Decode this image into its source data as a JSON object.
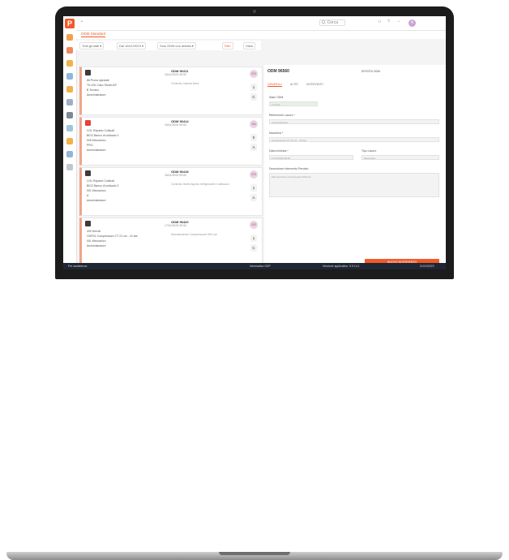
{
  "app": {
    "logo_letter": "P",
    "tab_label": "ODM Standard",
    "search_placeholder": "Q. Cerca",
    "avatar_initial": "A"
  },
  "filters": {
    "chip1": "Tutti gli stati ▾",
    "chip2": "Dal 16/11/2023 ▾",
    "chip3": "Solo ODM con attività ▾",
    "chip4": "Filtri",
    "chip5": "Vista"
  },
  "cards": [
    {
      "code": "ODM 96411",
      "date": "16/11/2023 09:00",
      "lines": [
        "86 Prova speciale",
        "TS-001 Caso Studio AP",
        "B Tecnico",
        "Amministratore"
      ],
      "mid": "Controllo valvola linea",
      "badge": "OS",
      "c1": "1",
      "c2": "C",
      "icon": "dark"
    },
    {
      "code": "ODM 96414",
      "date": "16/11/2023 09:00",
      "lines": [
        "COL Reparto Collaudi",
        "BIO2 Banco di collaudo 2",
        "005 Meccanico",
        "PRO",
        "Amministratore"
      ],
      "mid": "",
      "badge": "SA",
      "c1": "0",
      "c2": "A",
      "icon": "red"
    },
    {
      "code": "ODM 96418",
      "date": "16/11/2023 09:00",
      "lines": [
        "COL Reparto Collaudi",
        "BIO2 Banco di collaudo 2",
        "001 Meccanico",
        "A",
        "Amministratore"
      ],
      "mid": "Controllo livello liquido refrigerante e rabbocco",
      "badge": "OS",
      "c1": "1",
      "c2": "A",
      "icon": "dark"
    },
    {
      "code": "ODM 96420",
      "date": "17/11/2023 09:00",
      "lines": [
        "409 Servizi",
        "CMP01 Compressore CT 21 cm - 10 bar",
        "001 Meccanico",
        "Amministratore"
      ],
      "mid": "Manutenzione Compressore 500 ore",
      "badge": "OS",
      "c1": "1",
      "c2": "C",
      "icon": "dark"
    }
  ],
  "detail": {
    "title": "ODM 96560",
    "tabs": [
      "GENERALI",
      "ALTRI",
      "INTERVENTI"
    ],
    "field_state_label": "Stato ODM",
    "field_state_value": "In corso",
    "field_worker_label": "Riferimento Lavoro *",
    "field_worker_value": "Amministratore",
    "field_machine_label": "Macchina *",
    "field_machine_value": "Compressore CT 21 cm - 10 bar",
    "field_date_label": "Data richiesta *",
    "field_date_value": "17/11/2023 09:00",
    "field_type_label": "Tipo Lavoro",
    "field_type_value": "Meccanico",
    "field_desc_label": "Descrizione Intervento Previsto",
    "field_desc_value": "Manutenzione Compressore 500 ore",
    "button_new": "NUOVO INTERVENTO",
    "action_label": "SPOSTA ODM"
  },
  "status": {
    "left": "Per assistenza:",
    "center": "Informativa GDP",
    "right": "Versione applicativo: 9.9.14.1",
    "time": "01/10/2023"
  },
  "colors": {
    "accent": "#f05a28",
    "status_bar": "#1f2633"
  }
}
